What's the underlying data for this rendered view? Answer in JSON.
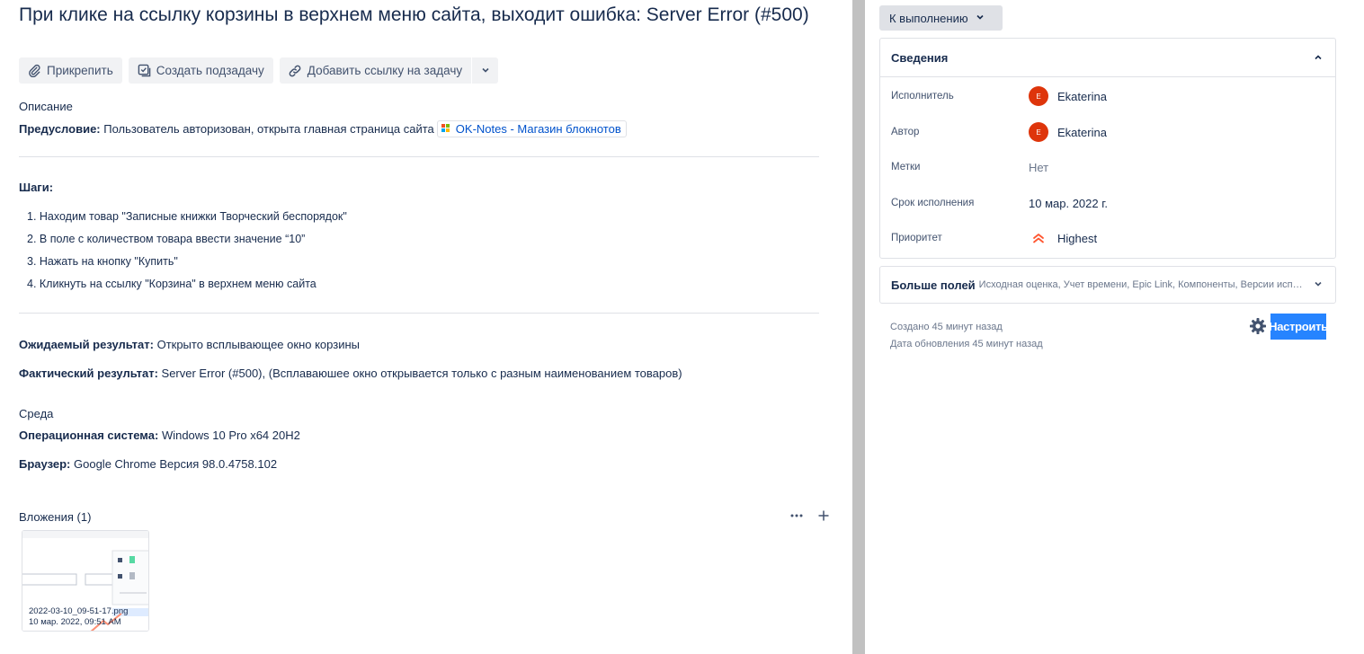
{
  "issue": {
    "title": "При клике на ссылку корзины в верхнем меню сайта, выходит ошибка: Server Error (#500)"
  },
  "toolbar": {
    "attach_label": "Прикрепить",
    "subtask_label": "Создать подзадачу",
    "link_label": "Добавить ссылку на задачу"
  },
  "description": {
    "heading": "Описание",
    "precondition_label": "Предусловие:",
    "precondition_text": "Пользователь авторизован, открыта главная страница сайта",
    "link_text": "OK-Notes - Магазин блокнотов",
    "steps_label": "Шаги:",
    "steps": [
      "1. Находим товар \"Записные книжки Творческий беспорядок\"",
      "2. В поле с количеством товара ввести значение “10”",
      "3. Нажать на кнопку \"Купить\"",
      "4. Кликнуть на ссылку \"Корзина\" в верхнем меню сайта"
    ],
    "expected_label": "Ожидаемый результат:",
    "expected_text": "Открыто всплывающее окно корзины",
    "actual_label": "Фактический результат:",
    "actual_text": "Server Error (#500), (Всплаваюшее окно открывается только с разным наименованием товаров)"
  },
  "environment": {
    "heading": "Среда",
    "os_label": "Операционная система:",
    "os_value": "Windows 10 Pro x64 20H2",
    "browser_label": "Браузер:",
    "browser_value": "Google Chrome Версия 98.0.4758.102"
  },
  "attachments": {
    "heading": "Вложения (1)",
    "items": [
      {
        "filename": "2022-03-10_09-51-17.png",
        "date": "10 мар. 2022, 09:51 AM"
      }
    ]
  },
  "sidebar": {
    "status_label": "К выполнению",
    "details_heading": "Сведения",
    "fields": {
      "assignee_label": "Исполнитель",
      "assignee_value": "Ekaterina",
      "assignee_initial": "E",
      "reporter_label": "Автор",
      "reporter_value": "Ekaterina",
      "reporter_initial": "E",
      "labels_label": "Метки",
      "labels_value": "Нет",
      "due_label": "Срок исполнения",
      "due_value": "10 мар. 2022 г.",
      "priority_label": "Приоритет",
      "priority_value": "Highest"
    },
    "more_fields_label": "Больше полей",
    "more_fields_summary": "Исходная оценка, Учет времени, Epic Link, Компоненты, Версии исправ...",
    "created_text": "Создано 45 минут назад",
    "updated_text": "Дата обновления 45 минут назад",
    "configure_label": "Настроить"
  },
  "colors": {
    "accent": "#2684ff",
    "avatar": "#de350b",
    "priority": "#ff5630",
    "link": "#0052cc"
  }
}
